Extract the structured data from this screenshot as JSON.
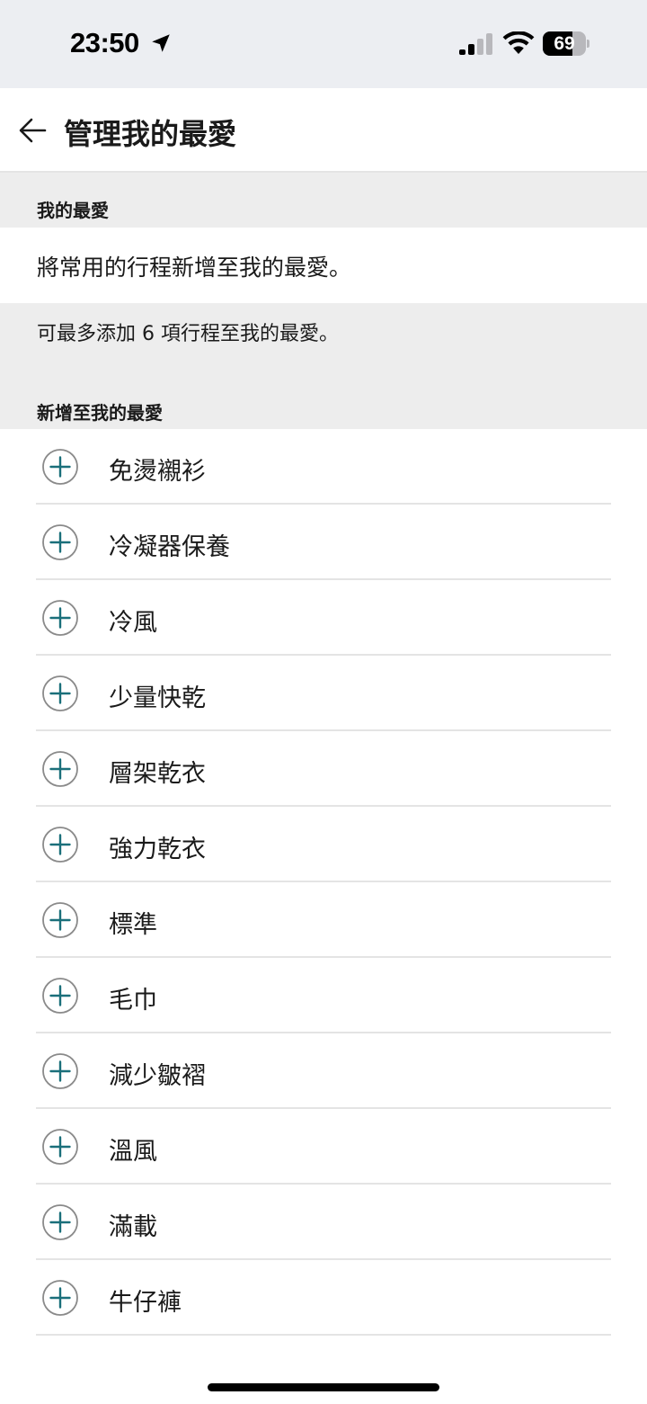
{
  "status_bar": {
    "time": "23:50",
    "battery_percent": 69,
    "battery_text": "69",
    "signal_bars_active": 2,
    "signal_bars_total": 4
  },
  "header": {
    "title": "管理我的最愛",
    "back_icon": "arrow-left-icon"
  },
  "favorites_section": {
    "heading": "我的最愛",
    "empty_text": "將常用的行程新增至我的最愛。",
    "limit_text": "可最多添加 6 項行程至我的最愛。"
  },
  "add_section": {
    "heading": "新增至我的最愛",
    "items": [
      {
        "label": "免燙襯衫"
      },
      {
        "label": "冷凝器保養"
      },
      {
        "label": "冷風"
      },
      {
        "label": "少量快乾"
      },
      {
        "label": "層架乾衣"
      },
      {
        "label": "強力乾衣"
      },
      {
        "label": "標準"
      },
      {
        "label": "毛巾"
      },
      {
        "label": "減少皺褶"
      },
      {
        "label": "溫風"
      },
      {
        "label": "滿載"
      },
      {
        "label": "牛仔褲"
      }
    ]
  },
  "colors": {
    "accent": "#1a6f7a",
    "icon_ring": "#8a8a8a",
    "section_bg": "#ededed",
    "status_bg": "#eceef2"
  }
}
